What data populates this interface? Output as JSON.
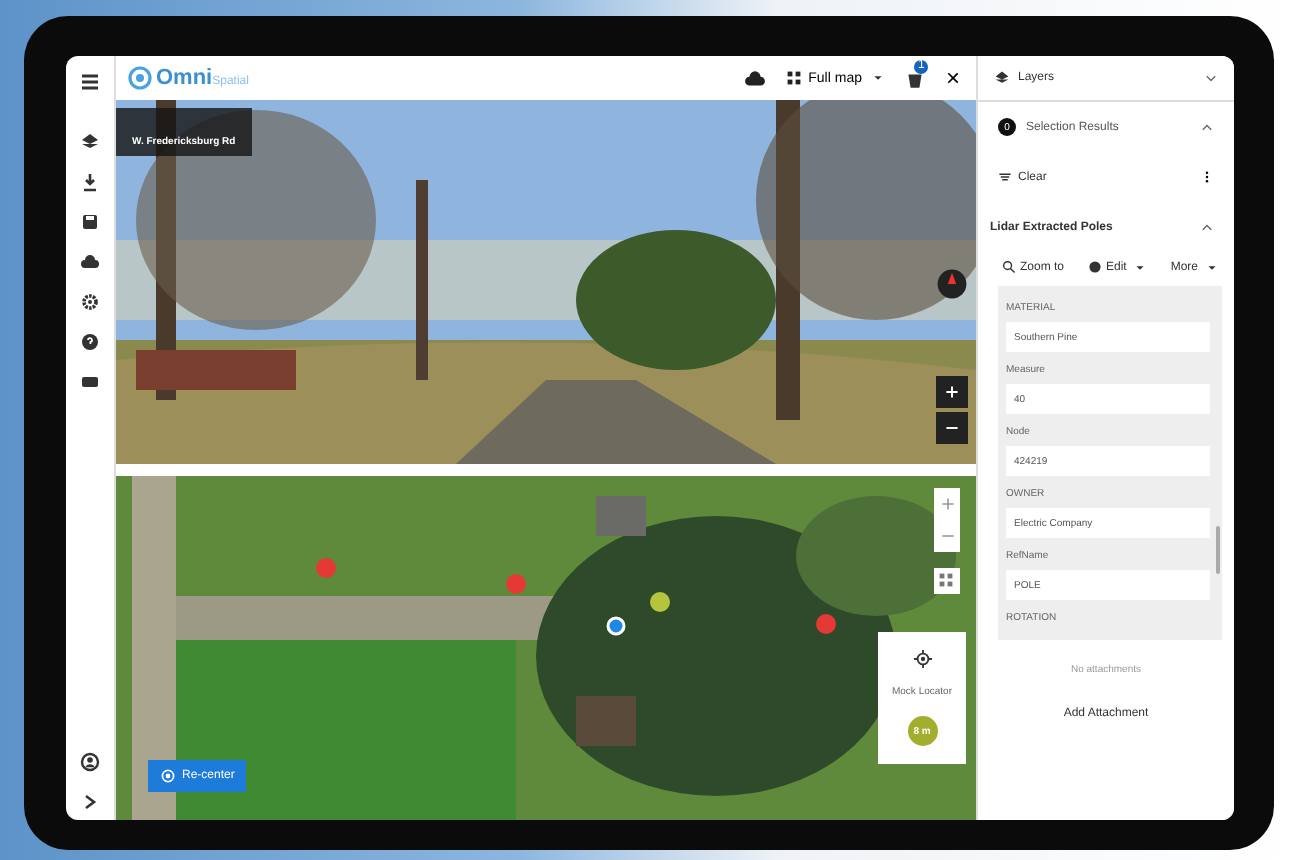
{
  "brand": {
    "name": "Omni",
    "suffix": "Spatial"
  },
  "toolbar": {
    "full_map": "Full map",
    "notifications": "1",
    "close": "×"
  },
  "street_view": {
    "address": "W. Fredericksburg Rd"
  },
  "map": {
    "locator_title": "Mock Locator",
    "accuracy": "8 m",
    "recenter": "Re-center"
  },
  "panel": {
    "layers": "Layers",
    "selection": {
      "title": "Selection Results",
      "count": "0",
      "expanded": true
    },
    "clear": "Clear",
    "layer": {
      "title": "Lidar Extracted Poles",
      "expanded": true
    },
    "actions": [
      "Zoom to",
      "Edit",
      "More"
    ],
    "fields": [
      {
        "label": "MATERIAL",
        "value": "Southern Pine"
      },
      {
        "label": "Measure",
        "value": "40"
      },
      {
        "label": "Node",
        "value": "424219"
      },
      {
        "label": "OWNER",
        "value": "Electric Company"
      },
      {
        "label": "RefName",
        "value": "POLE"
      },
      {
        "label": "ROTATION"
      }
    ],
    "no_attachments": "No attachments",
    "add_attachment": "Add Attachment"
  }
}
